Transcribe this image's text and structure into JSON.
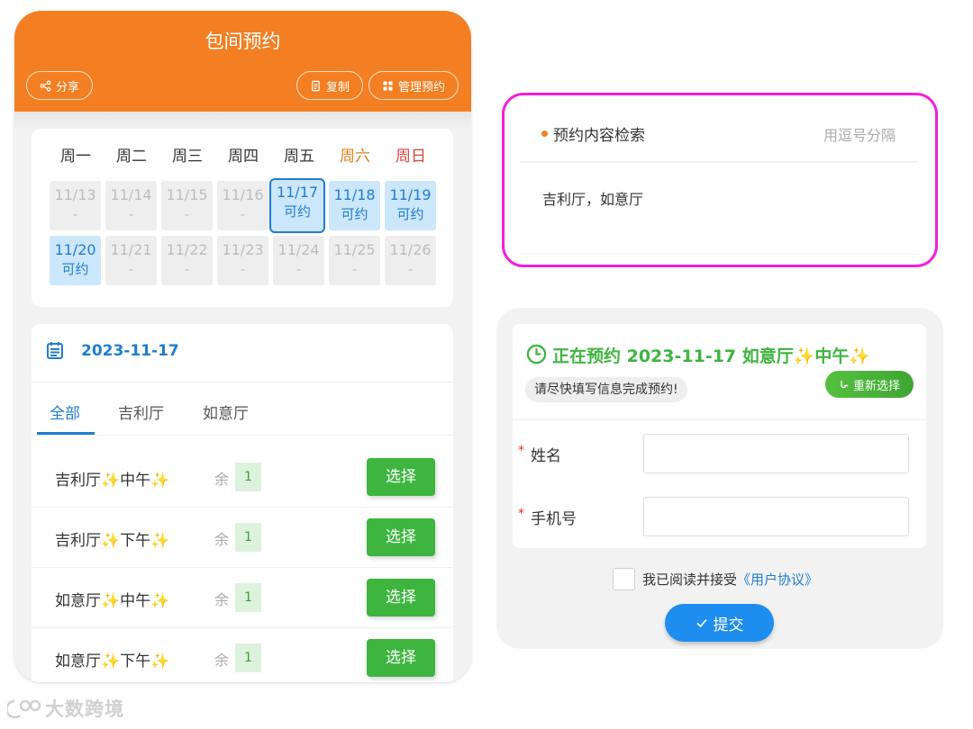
{
  "header": {
    "title": "包间预约",
    "share_label": "分享",
    "copy_label": "复制",
    "manage_label": "管理预约",
    "bg_color": "#f47f22"
  },
  "calendar": {
    "weekdays": [
      "周一",
      "周二",
      "周三",
      "周四",
      "周五",
      "周六",
      "周日"
    ],
    "weeks": [
      [
        {
          "date": "11/13",
          "status": "-",
          "available": false,
          "selected": false
        },
        {
          "date": "11/14",
          "status": "-",
          "available": false,
          "selected": false
        },
        {
          "date": "11/15",
          "status": "-",
          "available": false,
          "selected": false
        },
        {
          "date": "11/16",
          "status": "-",
          "available": false,
          "selected": false
        },
        {
          "date": "11/17",
          "status": "可约",
          "available": true,
          "selected": true
        },
        {
          "date": "11/18",
          "status": "可约",
          "available": true,
          "selected": false
        },
        {
          "date": "11/19",
          "status": "可约",
          "available": true,
          "selected": false
        }
      ],
      [
        {
          "date": "11/20",
          "status": "可约",
          "available": true,
          "selected": false
        },
        {
          "date": "11/21",
          "status": "-",
          "available": false,
          "selected": false
        },
        {
          "date": "11/22",
          "status": "-",
          "available": false,
          "selected": false
        },
        {
          "date": "11/23",
          "status": "-",
          "available": false,
          "selected": false
        },
        {
          "date": "11/24",
          "status": "-",
          "available": false,
          "selected": false
        },
        {
          "date": "11/25",
          "status": "-",
          "available": false,
          "selected": false
        },
        {
          "date": "11/26",
          "status": "-",
          "available": false,
          "selected": false
        }
      ]
    ],
    "accent_color": "#1f7dd1"
  },
  "slots": {
    "date": "2023-11-17",
    "tabs": [
      "全部",
      "吉利厅",
      "如意厅"
    ],
    "active_tab": 0,
    "remaining_label": "余",
    "items": [
      {
        "name": "吉利厅✨中午✨",
        "count": "1",
        "button": "选择"
      },
      {
        "name": "吉利厅✨下午✨",
        "count": "1",
        "button": "选择"
      },
      {
        "name": "如意厅✨中午✨",
        "count": "1",
        "button": "选择"
      },
      {
        "name": "如意厅✨下午✨",
        "count": "1",
        "button": "选择"
      }
    ]
  },
  "search": {
    "title": "预约内容检索",
    "hint": "用逗号分隔",
    "value": "吉利厅，如意厅"
  },
  "booking": {
    "title": "正在预约 2023-11-17 如意厅✨中午✨",
    "note": "请尽快填写信息完成预约!",
    "reselect_label": "重新选择",
    "name_label": "姓名",
    "phone_label": "手机号",
    "required_mark": "*",
    "agree_text": "我已阅读并接受",
    "agree_link": "《用户协议》",
    "submit_label": "提交",
    "green_color": "#3db53f"
  },
  "watermark": "大数跨境"
}
